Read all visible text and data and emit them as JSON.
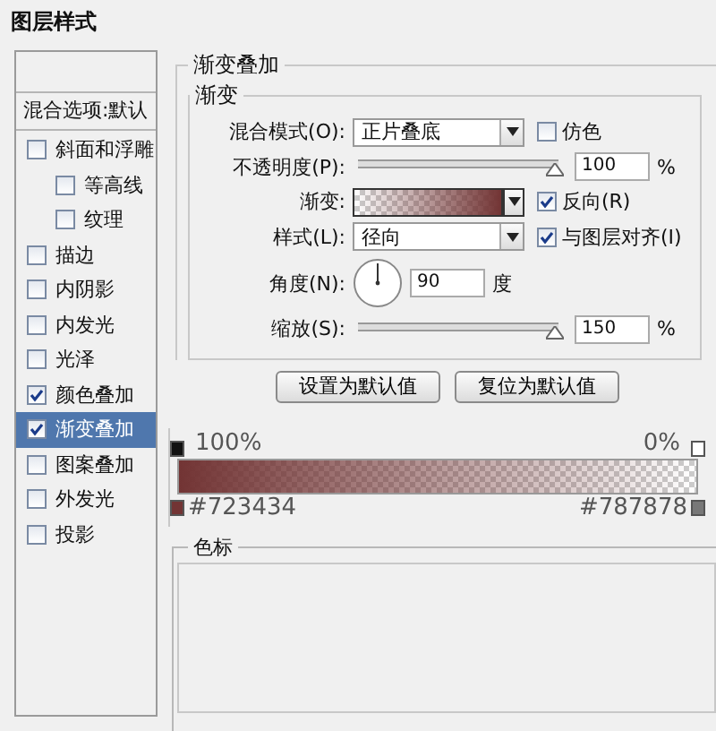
{
  "window": {
    "title": "图层样式"
  },
  "styles_list": {
    "header": "混合选项:默认",
    "items": [
      {
        "label": "斜面和浮雕",
        "checked": false,
        "selected": false,
        "children": [
          {
            "label": "等高线",
            "checked": false,
            "selected": false
          },
          {
            "label": "纹理",
            "checked": false,
            "selected": false
          }
        ]
      },
      {
        "label": "描边",
        "checked": false,
        "selected": false
      },
      {
        "label": "内阴影",
        "checked": false,
        "selected": false
      },
      {
        "label": "内发光",
        "checked": false,
        "selected": false
      },
      {
        "label": "光泽",
        "checked": false,
        "selected": false
      },
      {
        "label": "颜色叠加",
        "checked": true,
        "selected": false
      },
      {
        "label": "渐变叠加",
        "checked": true,
        "selected": true
      },
      {
        "label": "图案叠加",
        "checked": false,
        "selected": false
      },
      {
        "label": "外发光",
        "checked": false,
        "selected": false
      },
      {
        "label": "投影",
        "checked": false,
        "selected": false
      }
    ]
  },
  "panel": {
    "title": "渐变叠加",
    "group": "渐变",
    "blend_mode": {
      "label": "混合模式(O):",
      "value": "正片叠底"
    },
    "dither": {
      "label": "仿色",
      "checked": false
    },
    "opacity": {
      "label": "不透明度(P):",
      "level": 1,
      "value": "100",
      "unit": "%"
    },
    "gradient": {
      "label": "渐变:"
    },
    "reverse": {
      "label": "反向(R)",
      "checked": true
    },
    "style": {
      "label": "样式(L):",
      "value": "径向"
    },
    "align": {
      "label": "与图层对齐(I)",
      "checked": true
    },
    "angle": {
      "label": "角度(N):",
      "value": "90",
      "unit": "度"
    },
    "scale": {
      "label": "缩放(S):",
      "level": 1,
      "value": "150",
      "unit": "%"
    },
    "buttons": [
      "设置为默认值",
      "复位为默认值"
    ]
  },
  "gradient_editor": {
    "left_opacity": "100%",
    "right_opacity": "0%",
    "left_color": "#723434",
    "right_color": "#787878",
    "section_label": "色标"
  }
}
